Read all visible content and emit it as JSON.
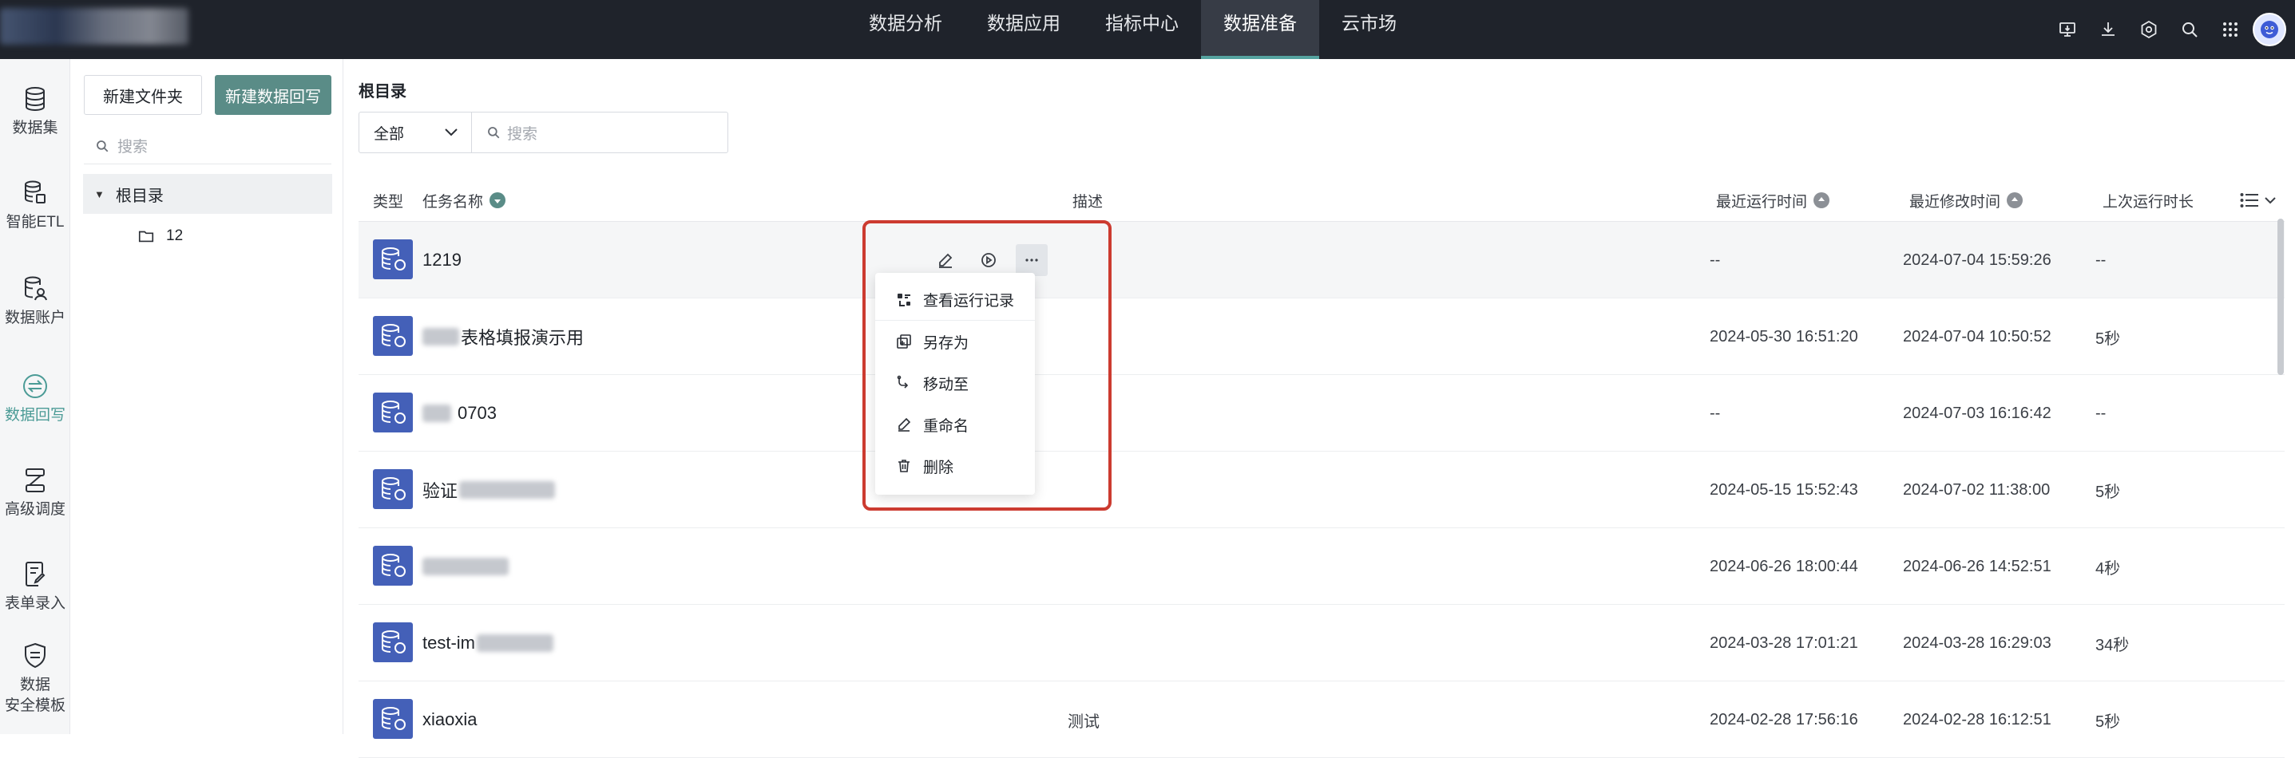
{
  "topnav": {
    "items": [
      {
        "label": "数据分析"
      },
      {
        "label": "数据应用"
      },
      {
        "label": "指标中心"
      },
      {
        "label": "数据准备",
        "active": true
      },
      {
        "label": "云市场"
      }
    ]
  },
  "rail": {
    "items": [
      {
        "label": "数据集",
        "icon": "database-icon"
      },
      {
        "label": "智能ETL",
        "icon": "etl-icon"
      },
      {
        "label": "数据账户",
        "icon": "data-account-icon"
      },
      {
        "label": "数据回写",
        "icon": "writeback-icon",
        "active": true
      },
      {
        "label": "高级调度",
        "icon": "schedule-icon"
      },
      {
        "label": "表单录入",
        "icon": "form-entry-icon"
      },
      {
        "label": "数据",
        "label2": "安全模板",
        "icon": "security-template-icon"
      }
    ]
  },
  "panel": {
    "new_folder": "新建文件夹",
    "new_writeback": "新建数据回写",
    "search_placeholder": "搜索",
    "root": "根目录",
    "child": "12"
  },
  "main": {
    "title": "根目录",
    "filter_value": "全部",
    "search_placeholder": "搜索",
    "columns": {
      "type": "类型",
      "name": "任务名称",
      "desc": "描述",
      "last_run": "最近运行时间",
      "last_modified": "最近修改时间",
      "duration": "上次运行时长"
    },
    "rows": [
      {
        "name": "1219",
        "desc": "",
        "last_run": "--",
        "last_modified": "2024-07-04 15:59:26",
        "duration": "--"
      },
      {
        "name": "表格填报演示用",
        "desc": "",
        "last_run": "2024-05-30 16:51:20",
        "last_modified": "2024-07-04 10:50:52",
        "duration": "5秒"
      },
      {
        "name": "0703",
        "desc": "",
        "last_run": "--",
        "last_modified": "2024-07-03 16:16:42",
        "duration": "--"
      },
      {
        "name": "验证",
        "desc": "",
        "last_run": "2024-05-15 15:52:43",
        "last_modified": "2024-07-02 11:38:00",
        "duration": "5秒"
      },
      {
        "name": "",
        "desc": "",
        "last_run": "2024-06-26 18:00:44",
        "last_modified": "2024-06-26 14:52:51",
        "duration": "4秒"
      },
      {
        "name": "test-im",
        "desc": "",
        "last_run": "2024-03-28 17:01:21",
        "last_modified": "2024-03-28 16:29:03",
        "duration": "34秒"
      },
      {
        "name": "xiaoxia",
        "desc": "测试",
        "last_run": "2024-02-28 17:56:16",
        "last_modified": "2024-02-28 16:12:51",
        "duration": "5秒"
      }
    ]
  },
  "dropdown": {
    "items": [
      {
        "label": "查看运行记录"
      },
      {
        "label": "另存为"
      },
      {
        "label": "移动至"
      },
      {
        "label": "重命名"
      },
      {
        "label": "删除"
      }
    ]
  },
  "colors": {
    "topbar": "#1f232b",
    "accent": "#5a8c87",
    "type_icon": "#4460b8",
    "highlight_box": "#cc3b30"
  }
}
